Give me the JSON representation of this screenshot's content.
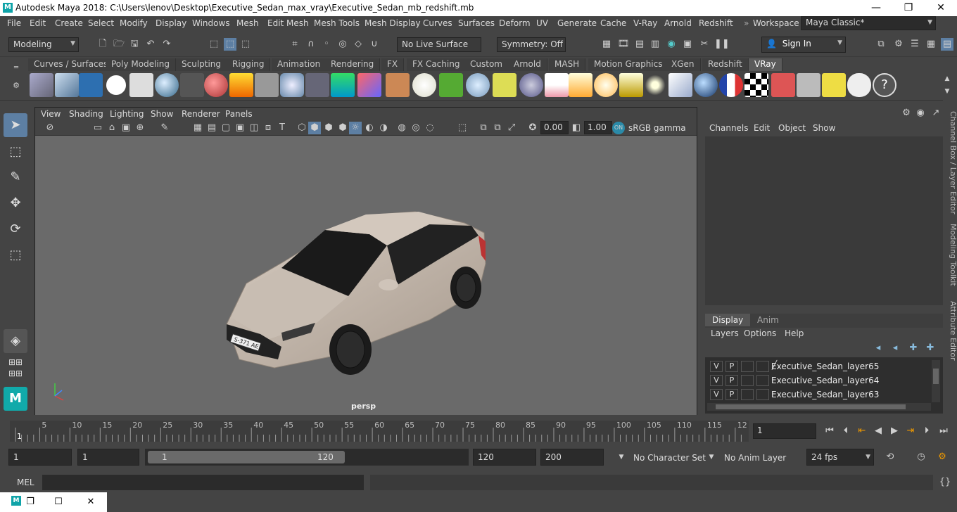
{
  "window": {
    "title": "Autodesk Maya 2018: C:\\Users\\lenov\\Desktop\\Executive_Sedan_max_vray\\Executive_Sedan_mb_redshift.mb",
    "minimize": "—",
    "maximize": "❐",
    "close": "✕"
  },
  "menubar": [
    "File",
    "Edit",
    "Create",
    "Select",
    "Modify",
    "Display",
    "Windows",
    "Mesh",
    "Edit Mesh",
    "Mesh Tools",
    "Mesh Display",
    "Curves",
    "Surfaces",
    "Deform",
    "UV",
    "Generate",
    "Cache",
    "V-Ray",
    "Arnold",
    "Redshift"
  ],
  "workspace": {
    "label": "Workspace :",
    "value": "Maya Classic*"
  },
  "statusline": {
    "mode": "Modeling",
    "live_surface": "No Live Surface",
    "symmetry": "Symmetry: Off",
    "sign_in": "Sign In"
  },
  "shelf_tabs": [
    "Curves / Surfaces",
    "Poly Modeling",
    "Sculpting",
    "Rigging",
    "Animation",
    "Rendering",
    "FX",
    "FX Caching",
    "Custom",
    "Arnold",
    "MASH",
    "Motion Graphics",
    "XGen",
    "Redshift",
    "VRay"
  ],
  "shelf_active": "VRay",
  "viewport": {
    "menu": [
      "View",
      "Shading",
      "Lighting",
      "Show",
      "Renderer",
      "Panels"
    ],
    "exposure": "0.00",
    "gamma": "1.00",
    "colorspace": "sRGB gamma",
    "camera": "persp",
    "plate_text": "S-371 AE 81"
  },
  "channelbox": {
    "menu": [
      "Channels",
      "Edit",
      "Object",
      "Show"
    ]
  },
  "layer_editor": {
    "tabs": [
      "Display",
      "Anim"
    ],
    "menu": [
      "Layers",
      "Options",
      "Help"
    ],
    "layers": [
      {
        "v": "V",
        "p": "P",
        "name": "Executive_Sedan_layer65"
      },
      {
        "v": "V",
        "p": "P",
        "name": "Executive_Sedan_layer64"
      },
      {
        "v": "V",
        "p": "P",
        "name": "Executive_Sedan_layer63"
      }
    ]
  },
  "side_tabs": [
    "Channel Box / Layer Editor",
    "Modeling Toolkit",
    "Attribute Editor"
  ],
  "timeline": {
    "ticks": [
      "1",
      "5",
      "10",
      "15",
      "20",
      "25",
      "30",
      "35",
      "40",
      "45",
      "50",
      "55",
      "60",
      "65",
      "70",
      "75",
      "80",
      "85",
      "90",
      "95",
      "100",
      "105",
      "110",
      "115",
      "12"
    ],
    "current_frame": "1"
  },
  "range": {
    "start": "1",
    "playback_start": "1",
    "slider_start": "1",
    "slider_end": "120",
    "playback_end": "120",
    "end": "200",
    "character_set": "No Character Set",
    "anim_layer": "No Anim Layer",
    "fps": "24 fps"
  },
  "cmdline": {
    "label": "MEL"
  }
}
